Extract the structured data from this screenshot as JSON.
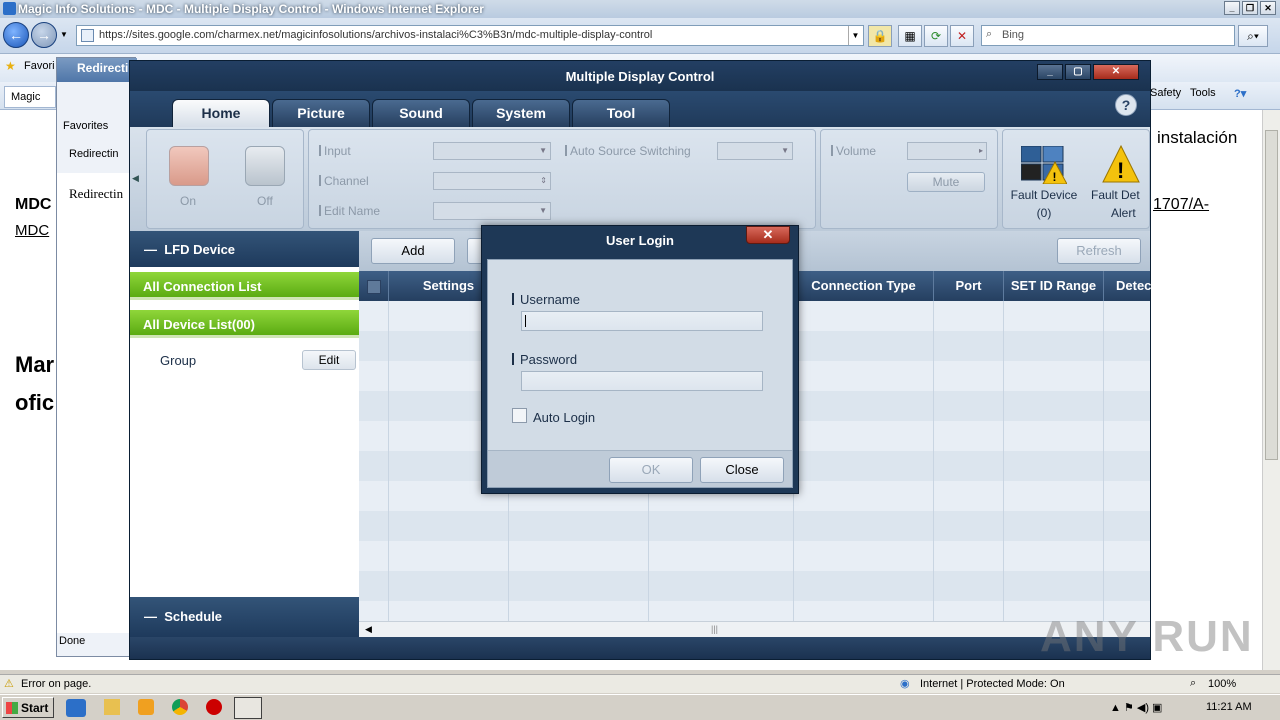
{
  "ie": {
    "window_title": "Magic Info Solutions - MDC - Multiple Display Control - Windows Internet Explorer",
    "url": "https://sites.google.com/charmex.net/magicinfosolutions/archivos-instalaci%C3%B3n/mdc-multiple-display-control",
    "search_placeholder": "Bing",
    "favorites_label": "Favori",
    "tab_label": "Redirectin",
    "tab2_label": "Magic",
    "cmd_safety": "Safety",
    "cmd_tools": "Tools",
    "page_partial_heading": "instalación",
    "page_link_partial": "1707/A-",
    "page_left_text_1": "MDC",
    "page_left_text_2": "MDC",
    "page_big_1": "Mar",
    "page_big_2": "ofic",
    "status_left": "Error on page.",
    "status_zone": "Internet | Protected Mode: On",
    "zoom": "100%"
  },
  "inner_ie": {
    "tab_label": "Redirecti",
    "favorites": "Favorites",
    "tab2": "Redirectin",
    "content": "Redirectin",
    "status": "Done"
  },
  "taskbar": {
    "start": "Start",
    "clock": "11:21 AM"
  },
  "mdc": {
    "title": "Multiple Display Control",
    "tabs": [
      "Home",
      "Picture",
      "Sound",
      "System",
      "Tool"
    ],
    "ribbon": {
      "on_label": "On",
      "off_label": "Off",
      "input_label": "Input",
      "channel_label": "Channel",
      "edit_name_label": "Edit Name",
      "auto_source_label": "Auto Source Switching",
      "volume_label": "Volume",
      "mute_label": "Mute",
      "fault_device_label": "Fault Device",
      "fault_device_count": "(0)",
      "fault_alert_label_1": "Fault Det",
      "fault_alert_label_2": "Alert"
    },
    "sidebar": {
      "lfd_header": "LFD Device",
      "all_connection": "All Connection List",
      "all_device": "All Device List(00)",
      "group_label": "Group",
      "edit_button": "Edit",
      "schedule_header": "Schedule"
    },
    "toolbar": {
      "add": "Add",
      "refresh": "Refresh"
    },
    "grid_columns": [
      "Settings",
      "Connection Type",
      "Port",
      "SET ID Range",
      "Detec"
    ]
  },
  "login": {
    "title": "User Login",
    "username_label": "Username",
    "password_label": "Password",
    "auto_login_label": "Auto Login",
    "ok_button": "OK",
    "close_button": "Close"
  },
  "watermark": "ANY RUN",
  "colors": {
    "accent_green": "#6ec020",
    "mdc_navy": "#1f3b5c",
    "ie_blue": "#2c6fc8"
  }
}
